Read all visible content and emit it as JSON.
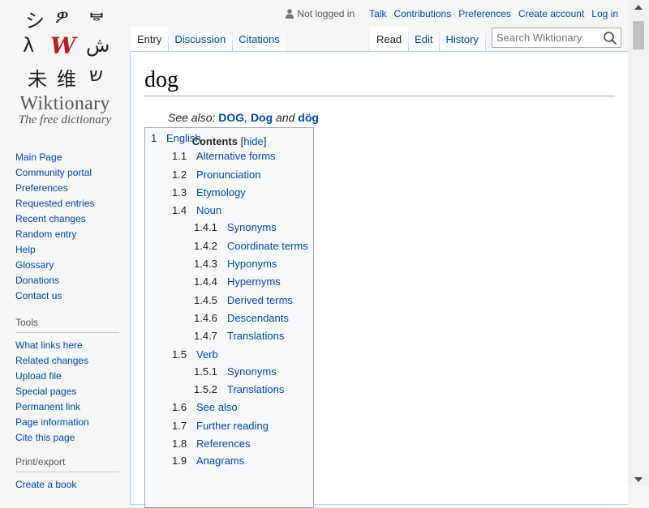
{
  "logo": {
    "glyphs": [
      "シ",
      "ዎ",
      "ᄫ",
      "λ",
      "W",
      "ش",
      "未",
      "维",
      "ש"
    ],
    "title": "Wiktionary",
    "tagline": "The free dictionary"
  },
  "nav": {
    "main": [
      "Main Page",
      "Community portal",
      "Preferences",
      "Requested entries",
      "Recent changes",
      "Random entry",
      "Help",
      "Glossary",
      "Donations",
      "Contact us"
    ],
    "tools_heading": "Tools",
    "tools": [
      "What links here",
      "Related changes",
      "Upload file",
      "Special pages",
      "Permanent link",
      "Page information",
      "Cite this page"
    ],
    "print_heading": "Print/export",
    "print": [
      "Create a book"
    ]
  },
  "personal": {
    "status": "Not logged in",
    "links": [
      "Talk",
      "Contributions",
      "Preferences",
      "Create account",
      "Log in"
    ]
  },
  "tabs_left": [
    "Entry",
    "Discussion",
    "Citations"
  ],
  "tabs_right": [
    "Read",
    "Edit",
    "History"
  ],
  "search": {
    "placeholder": "Search Wiktionary"
  },
  "page": {
    "title": "dog",
    "see_also_prefix": "See also:",
    "see_also": [
      "DOG",
      "Dog",
      "dög"
    ],
    "see_also_sep": ",",
    "see_also_and": "and"
  },
  "toc": {
    "title": "Contents",
    "hide_open": "[",
    "hide": "hide",
    "hide_close": "]",
    "items": [
      {
        "num": "1",
        "text": "English",
        "level": 1
      },
      {
        "num": "1.1",
        "text": "Alternative forms",
        "level": 2
      },
      {
        "num": "1.2",
        "text": "Pronunciation",
        "level": 2
      },
      {
        "num": "1.3",
        "text": "Etymology",
        "level": 2
      },
      {
        "num": "1.4",
        "text": "Noun",
        "level": 2
      },
      {
        "num": "1.4.1",
        "text": "Synonyms",
        "level": 3
      },
      {
        "num": "1.4.2",
        "text": "Coordinate terms",
        "level": 3
      },
      {
        "num": "1.4.3",
        "text": "Hyponyms",
        "level": 3
      },
      {
        "num": "1.4.4",
        "text": "Hypernyms",
        "level": 3
      },
      {
        "num": "1.4.5",
        "text": "Derived terms",
        "level": 3
      },
      {
        "num": "1.4.6",
        "text": "Descendants",
        "level": 3
      },
      {
        "num": "1.4.7",
        "text": "Translations",
        "level": 3
      },
      {
        "num": "1.5",
        "text": "Verb",
        "level": 2
      },
      {
        "num": "1.5.1",
        "text": "Synonyms",
        "level": 3
      },
      {
        "num": "1.5.2",
        "text": "Translations",
        "level": 3
      },
      {
        "num": "1.6",
        "text": "See also",
        "level": 2
      },
      {
        "num": "1.7",
        "text": "Further reading",
        "level": 2
      },
      {
        "num": "1.8",
        "text": "References",
        "level": 2
      },
      {
        "num": "1.9",
        "text": "Anagrams",
        "level": 2
      }
    ]
  },
  "colors": {
    "link": "#0645ad",
    "tab_border": "#a7d7f9",
    "logo_accent": "#b51f24"
  },
  "icons": [
    "user-icon",
    "search-icon",
    "scroll-up-icon",
    "scroll-down-icon"
  ]
}
